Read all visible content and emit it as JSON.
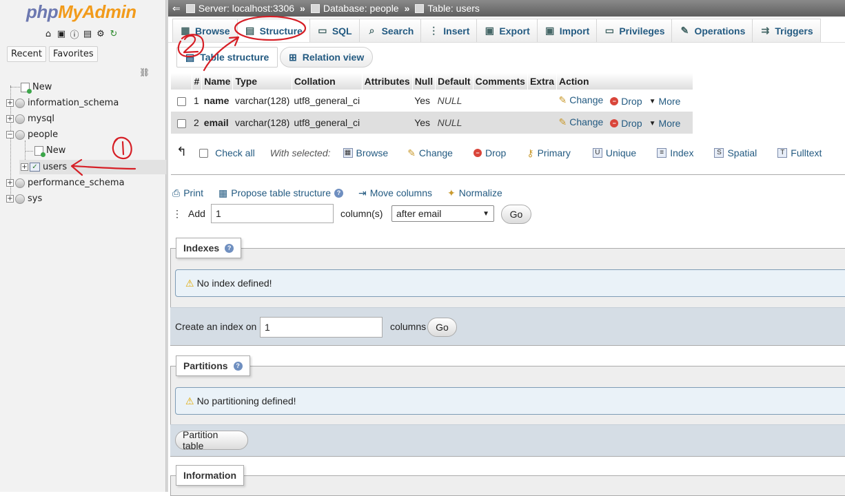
{
  "app": {
    "logo_part1": "php",
    "logo_part2": "MyAdmin"
  },
  "nav": {
    "tabs": [
      "Recent",
      "Favorites"
    ],
    "tree": [
      {
        "label": "New",
        "kind": "new"
      },
      {
        "label": "information_schema",
        "kind": "db"
      },
      {
        "label": "mysql",
        "kind": "db"
      },
      {
        "label": "people",
        "kind": "db",
        "expanded": true
      },
      {
        "label": "New",
        "kind": "new"
      },
      {
        "label": "users",
        "kind": "table",
        "selected": true
      },
      {
        "label": "performance_schema",
        "kind": "db"
      },
      {
        "label": "sys",
        "kind": "db"
      }
    ]
  },
  "breadcrumb": {
    "server": "Server: localhost:3306",
    "database": "Database: people",
    "table": "Table: users",
    "sep": "»"
  },
  "tabs": [
    "Browse",
    "Structure",
    "SQL",
    "Search",
    "Insert",
    "Export",
    "Import",
    "Privileges",
    "Operations",
    "Triggers"
  ],
  "active_tab": "Structure",
  "subtabs": [
    "Table structure",
    "Relation view"
  ],
  "structure": {
    "headers": [
      "#",
      "Name",
      "Type",
      "Collation",
      "Attributes",
      "Null",
      "Default",
      "Comments",
      "Extra",
      "Action"
    ],
    "rows": [
      {
        "num": "1",
        "name": "name",
        "type": "varchar(128)",
        "collation": "utf8_general_ci",
        "attributes": "",
        "null": "Yes",
        "default": "NULL",
        "comments": "",
        "extra": ""
      },
      {
        "num": "2",
        "name": "email",
        "type": "varchar(128)",
        "collation": "utf8_general_ci",
        "attributes": "",
        "null": "Yes",
        "default": "NULL",
        "comments": "",
        "extra": ""
      }
    ],
    "actions": {
      "change": "Change",
      "drop": "Drop",
      "more": "More"
    }
  },
  "with_selected": {
    "check_all": "Check all",
    "label": "With selected:",
    "items": [
      "Browse",
      "Change",
      "Drop",
      "Primary",
      "Unique",
      "Index",
      "Spatial",
      "Fulltext"
    ]
  },
  "links": {
    "print": "Print",
    "propose": "Propose table structure",
    "move": "Move columns",
    "normalize": "Normalize"
  },
  "add_columns": {
    "label": "Add",
    "value": "1",
    "unit": "column(s)",
    "position": "after email",
    "go": "Go"
  },
  "indexes": {
    "legend": "Indexes",
    "notice": "No index defined!",
    "create_label": "Create an index on",
    "create_value": "1",
    "columns_label": "columns",
    "go": "Go"
  },
  "partitions": {
    "legend": "Partitions",
    "notice": "No partitioning defined!",
    "button": "Partition table"
  },
  "information": {
    "legend": "Information"
  },
  "colors": {
    "link": "#235a81",
    "annotation": "#d61f26",
    "breadcrumb_bg": "#6f6f6f"
  }
}
